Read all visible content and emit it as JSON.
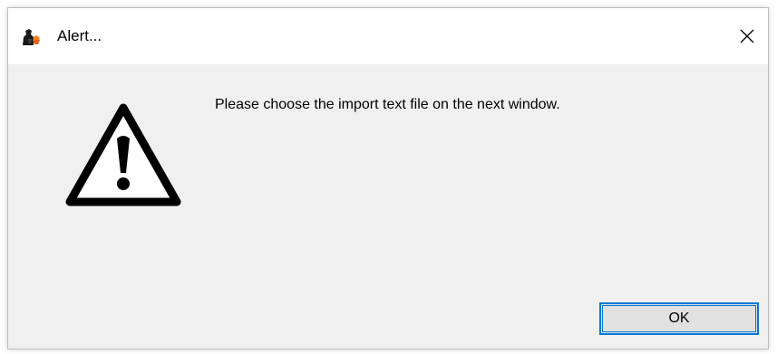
{
  "dialog": {
    "title": "Alert...",
    "app_icon": "app-logo-icon",
    "close_icon": "close-icon",
    "warning_icon": "warning-triangle-icon",
    "message": "Please choose the import text file on the next window.",
    "ok_label": "OK"
  },
  "colors": {
    "title_bar": "#ffffff",
    "body": "#f0f0f0",
    "button_face": "#e1e1e1",
    "focus_accent": "#0078d7"
  }
}
